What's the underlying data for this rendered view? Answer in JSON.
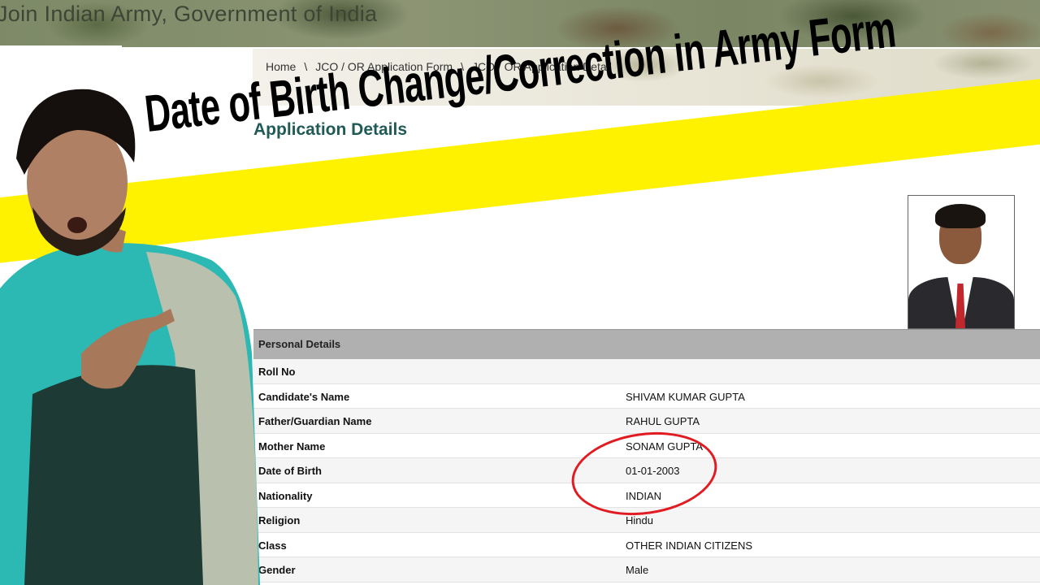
{
  "header": {
    "title": "Join Indian Army, Government of India"
  },
  "breadcrumb": {
    "home": "Home",
    "sep": "\\",
    "item2": "JCO / OR Application Form",
    "item3": "JCO / OR Application Detail"
  },
  "page": {
    "heading": "Application Details"
  },
  "banner": {
    "text": "Date of Birth Change/Correction in Army Form",
    "color": "#fff200"
  },
  "table": {
    "header": "Personal Details",
    "rows": [
      {
        "label": "Roll No",
        "value": ""
      },
      {
        "label": "Candidate's Name",
        "value": "SHIVAM KUMAR GUPTA"
      },
      {
        "label": "Father/Guardian Name",
        "value": "RAHUL GUPTA"
      },
      {
        "label": "Mother Name",
        "value": "SONAM GUPTA"
      },
      {
        "label": "Date of Birth",
        "value": "01-01-2003"
      },
      {
        "label": "Nationality",
        "value": "INDIAN"
      },
      {
        "label": "Religion",
        "value": "Hindu"
      },
      {
        "label": "Class",
        "value": "OTHER INDIAN CITIZENS"
      },
      {
        "label": "Gender",
        "value": "Male"
      }
    ]
  },
  "colors": {
    "highlight_circle": "#e01b22",
    "table_header": "#b0b0b0",
    "heading": "#1f5a57"
  }
}
